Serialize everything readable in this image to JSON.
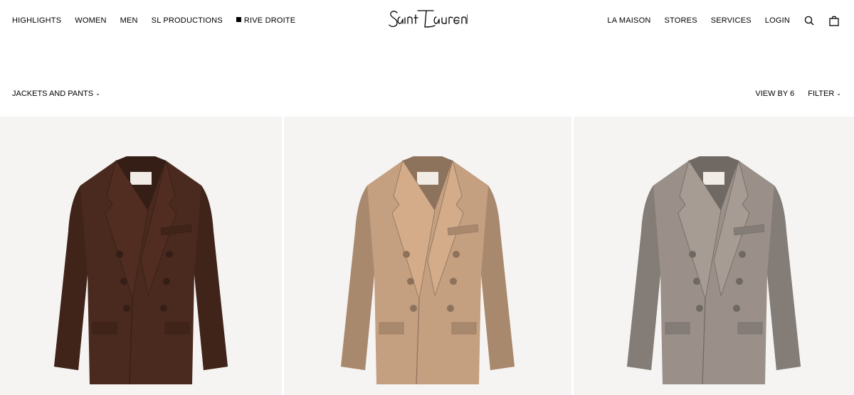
{
  "header": {
    "nav_left": [
      "HIGHLIGHTS",
      "WOMEN",
      "MEN",
      "SL PRODUCTIONS",
      "RIVE DROITE"
    ],
    "logo": "SAINT LAURENT",
    "nav_right": [
      "LA MAISON",
      "STORES",
      "SERVICES",
      "LOGIN"
    ],
    "icons": [
      "search-icon",
      "shopping-bag-icon"
    ]
  },
  "toolbar": {
    "category": "JACKETS AND PANTS",
    "view_by": "VIEW BY 6",
    "filter": "FILTER"
  },
  "products": [
    {
      "name": "double-breasted jacket",
      "color": "#4a2a1e"
    },
    {
      "name": "double-breasted jacket",
      "color": "#c49f80"
    },
    {
      "name": "double-breasted jacket",
      "color": "#9a9089"
    }
  ]
}
